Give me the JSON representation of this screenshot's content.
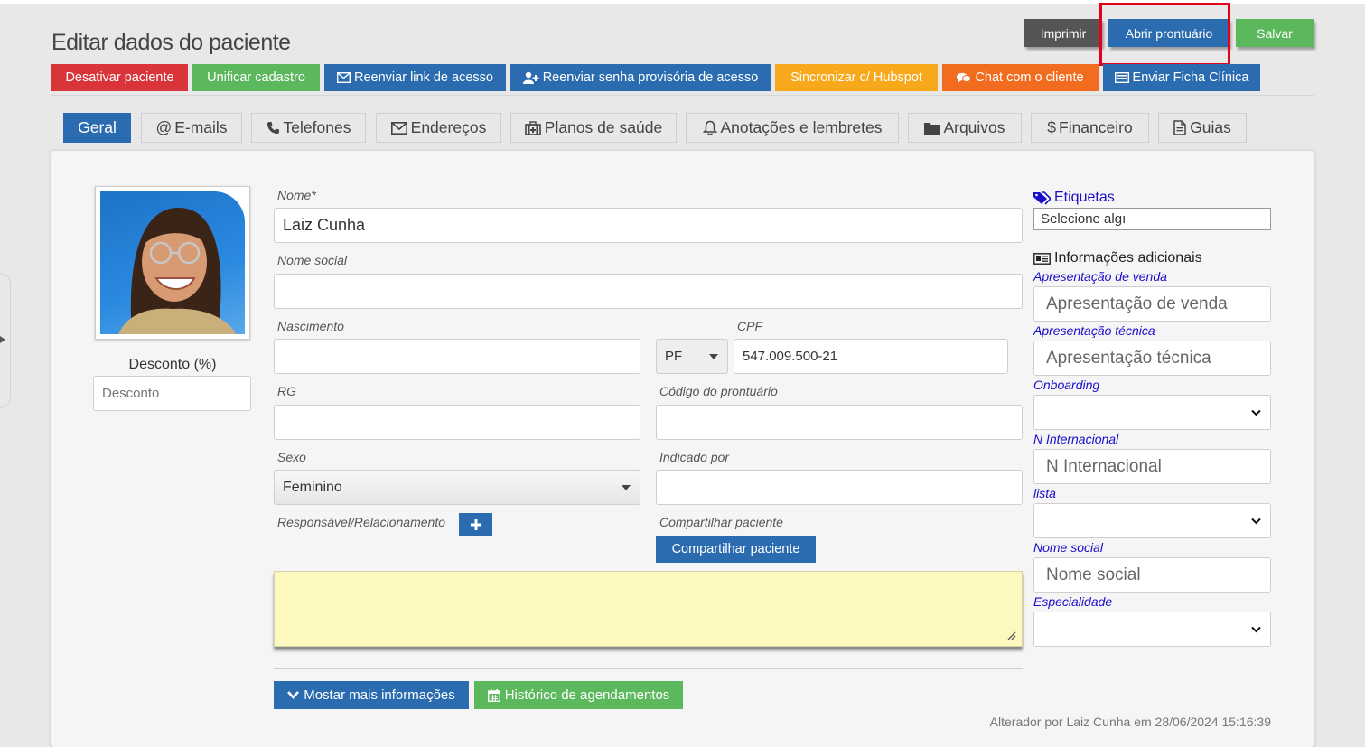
{
  "page_title": "Editar dados do paciente",
  "header_buttons": {
    "print": "Imprimir",
    "open_record": "Abrir prontuário",
    "save": "Salvar"
  },
  "action_buttons": {
    "deactivate": "Desativar paciente",
    "merge": "Unificar cadastro",
    "resend_link": "Reenviar link de acesso",
    "resend_password": "Reenviar senha provisória de acesso",
    "sync_hubspot": "Sincronizar c/ Hubspot",
    "chat": "Chat com o cliente",
    "send_form": "Enviar Ficha Clínica"
  },
  "tabs": [
    {
      "label": "Geral",
      "icon": "none"
    },
    {
      "label": "E-mails",
      "icon": "at-icon"
    },
    {
      "label": "Telefones",
      "icon": "phone-icon"
    },
    {
      "label": "Endereços",
      "icon": "envelope-icon"
    },
    {
      "label": "Planos de saúde",
      "icon": "medkit-icon"
    },
    {
      "label": "Anotações e lembretes",
      "icon": "bell-icon"
    },
    {
      "label": "Arquivos",
      "icon": "folder-icon"
    },
    {
      "label": "Financeiro",
      "icon": "dollar-icon"
    },
    {
      "label": "Guias",
      "icon": "document-icon"
    }
  ],
  "form": {
    "nome_label": "Nome*",
    "nome_value": "Laiz Cunha",
    "nome_social_label": "Nome social",
    "nome_social_value": "",
    "nascimento_label": "Nascimento",
    "nascimento_value": "",
    "cpf_label": "CPF",
    "doc_type": "PF",
    "cpf_value": "547.009.500-21",
    "rg_label": "RG",
    "rg_value": "",
    "codigo_label": "Código do prontuário",
    "codigo_value": "",
    "sexo_label": "Sexo",
    "sexo_value": "Feminino",
    "indicado_label": "Indicado por",
    "indicado_value": "",
    "responsavel_label": "Responsável/Relacionamento",
    "compartilhar_label": "Compartilhar paciente",
    "compartilhar_button": "Compartilhar paciente",
    "notes_value": ""
  },
  "discount": {
    "label": "Desconto (%)",
    "placeholder": "Desconto"
  },
  "right_panel": {
    "tags_label": "Etiquetas",
    "tags_placeholder": "Selecione algı",
    "additional_info_title": "Informações adicionais",
    "fields": [
      {
        "label": "Apresentação de venda",
        "type": "text",
        "placeholder": "Apresentação de venda"
      },
      {
        "label": "Apresentação técnica",
        "type": "text",
        "placeholder": "Apresentação técnica"
      },
      {
        "label": "Onboarding",
        "type": "select",
        "placeholder": ""
      },
      {
        "label": "N Internacional",
        "type": "text",
        "placeholder": "N Internacional"
      },
      {
        "label": "lista",
        "type": "select",
        "placeholder": ""
      },
      {
        "label": "Nome social",
        "type": "text",
        "placeholder": "Nome social"
      },
      {
        "label": "Especialidade",
        "type": "select",
        "placeholder": ""
      }
    ]
  },
  "bottom": {
    "more_info": "Mostar mais informações",
    "history": "Histórico de agendamentos",
    "altered_by": "Alterador por Laiz Cunha em 28/06/2024 15:16:39"
  },
  "colors": {
    "primary": "#2b6cb0",
    "success": "#5cb85c",
    "danger": "#d9343a",
    "warning": "#f7a81b",
    "orange": "#f26c1f",
    "dark": "#555555",
    "highlight": "#e3001b",
    "notes_bg": "#fdf8c0"
  }
}
